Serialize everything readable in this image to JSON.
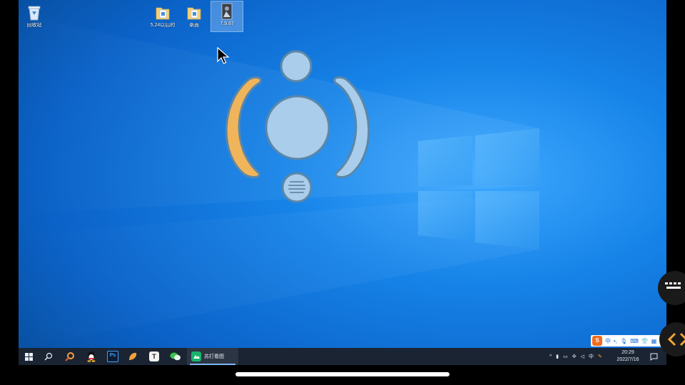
{
  "desktop": {
    "icons": [
      {
        "label": "回收站",
        "icon": "recycle-bin-icon"
      },
      {
        "label": "5.24以后的",
        "icon": "folder-icon"
      },
      {
        "label": "桌面",
        "icon": "folder-icon"
      },
      {
        "label": "7.9.87",
        "icon": "image-file-icon",
        "selected": true
      }
    ]
  },
  "float_controller": {
    "icons": [
      "top-circle",
      "left-arc",
      "center-circle",
      "right-arc",
      "menu-icon"
    ],
    "colors": {
      "fill": "#a9cdea",
      "active_fill": "#f0b55a",
      "border": "#5c87a8"
    }
  },
  "taskbar": {
    "start_icon": "windows-start-icon",
    "search_icon": "search-icon",
    "pinned": [
      "browser-icon",
      "qq-icon",
      "photoshop-icon",
      "app-icon",
      "typora-icon",
      "wechat-icon"
    ],
    "photoshop_label": "Ps",
    "typora_label": "T",
    "active_app": {
      "label": "苏打看图",
      "icon": "sudakantu-icon"
    },
    "tray_lang": "中",
    "clock_time": "20:29",
    "clock_date": "2022/7/16"
  },
  "ime": {
    "brand": "S",
    "lang": "中",
    "items": [
      "punctuation-icon",
      "mic-icon",
      "keyboard-icon",
      "skin-icon",
      "grid-icon"
    ]
  },
  "colors": {
    "taskbar_bg": "#1b2433",
    "desktop_blue": "#0b62c8",
    "accent": "#f0b55a"
  }
}
